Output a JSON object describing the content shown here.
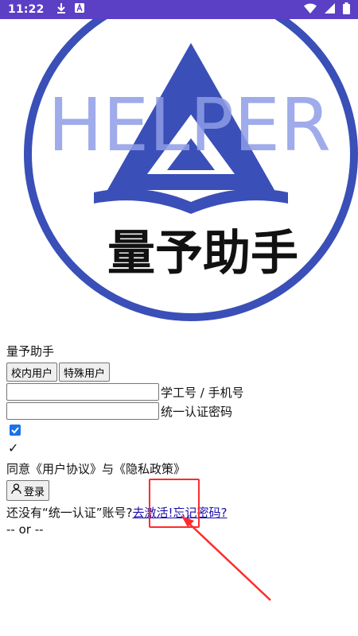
{
  "status_bar": {
    "time": "11:22",
    "left_icons": [
      "download-icon",
      "a-box-icon"
    ],
    "right_icons": [
      "wifi-icon",
      "cell-signal-icon",
      "battery-icon"
    ]
  },
  "logo": {
    "word": "HELPER",
    "name": "量予助手",
    "colors": {
      "primary": "#3a4fb7",
      "light": "#8e9ce6"
    }
  },
  "app_title": "量予助手",
  "tabs": [
    {
      "label": "校内用户"
    },
    {
      "label": "特殊用户"
    }
  ],
  "fields": {
    "account_label": "学工号 / 手机号",
    "account_value": "",
    "password_label": "统一认证密码",
    "password_value": ""
  },
  "agree": {
    "checked": true,
    "checkmark": "✓",
    "text": "同意《用户协议》与《隐私政策》"
  },
  "login_button": {
    "label": "登录",
    "icon": "user-icon"
  },
  "hint": {
    "prefix": "还没有“统一认证”账号?",
    "activate_link": "去激活!",
    "forgot_link": "忘记密码?"
  },
  "or_text": "-- or --",
  "annotation": {
    "color": "#ff2b2b"
  }
}
